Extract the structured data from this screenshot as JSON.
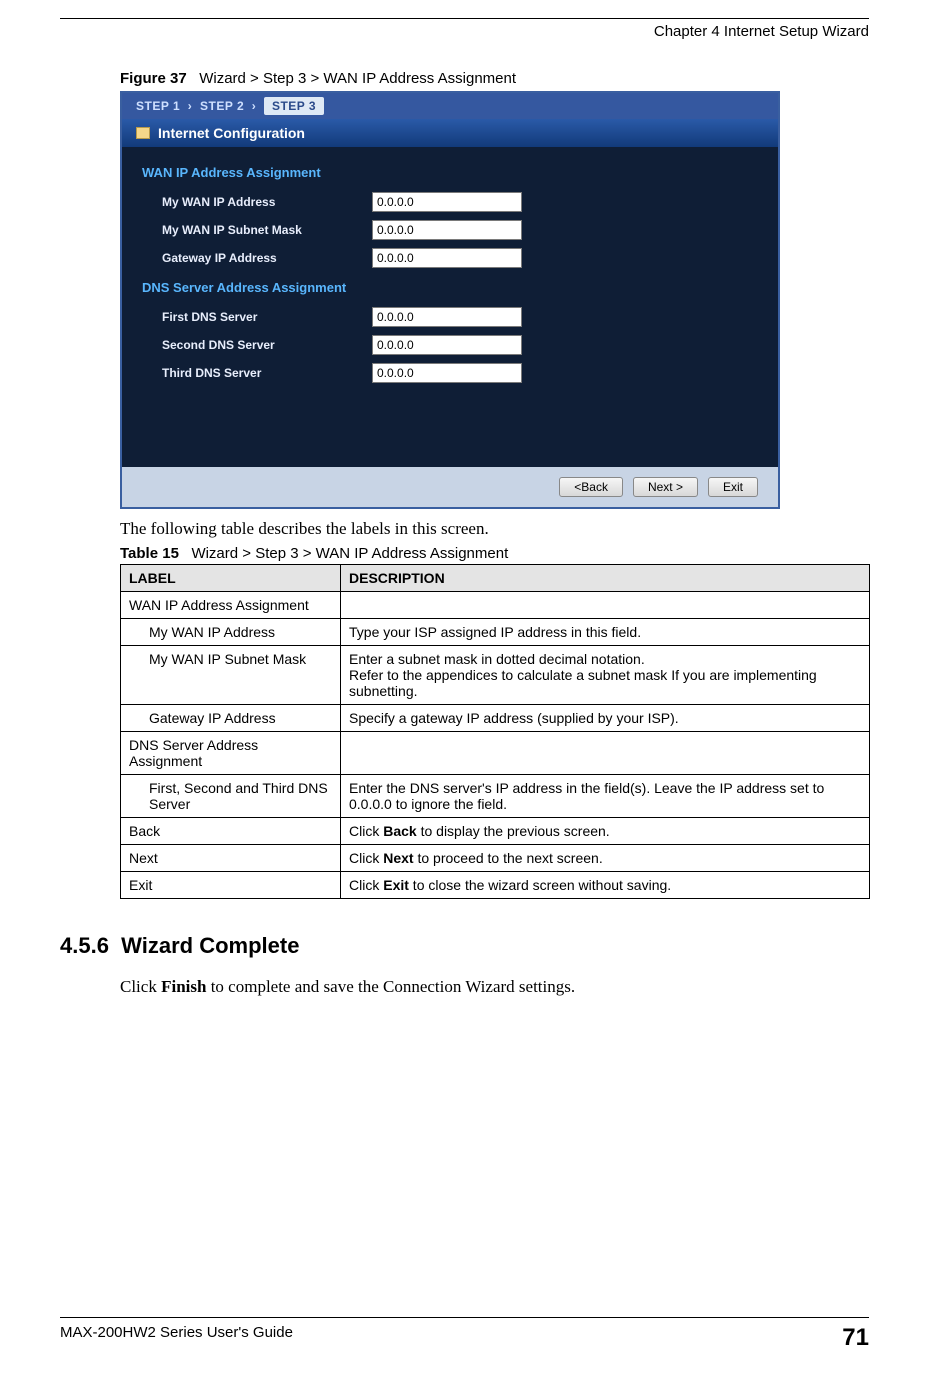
{
  "header": {
    "chapter": "Chapter 4 Internet Setup Wizard"
  },
  "figure": {
    "label": "Figure 37",
    "caption": "Wizard > Step 3 > WAN IP Address Assignment"
  },
  "screenshot": {
    "steps": {
      "s1": "STEP 1",
      "s2": "STEP 2",
      "s3": "STEP 3"
    },
    "panel_title": "Internet Configuration",
    "wan_section": "WAN IP Address Assignment",
    "wan_fields": {
      "ip_label": "My WAN IP Address",
      "ip_value": "0.0.0.0",
      "mask_label": "My WAN IP Subnet Mask",
      "mask_value": "0.0.0.0",
      "gw_label": "Gateway IP Address",
      "gw_value": "0.0.0.0"
    },
    "dns_section": "DNS Server Address Assignment",
    "dns_fields": {
      "d1_label": "First DNS Server",
      "d1_value": "0.0.0.0",
      "d2_label": "Second DNS Server",
      "d2_value": "0.0.0.0",
      "d3_label": "Third DNS Server",
      "d3_value": "0.0.0.0"
    },
    "buttons": {
      "back": "<Back",
      "next": "Next >",
      "exit": "Exit"
    }
  },
  "body": {
    "intro": "The following table describes the labels in this screen."
  },
  "table": {
    "label": "Table 15",
    "caption": "Wizard > Step 3 > WAN IP Address Assignment",
    "headers": {
      "c1": "LABEL",
      "c2": "DESCRIPTION"
    },
    "rows": [
      {
        "label": "WAN IP Address Assignment",
        "desc": "",
        "indent": false
      },
      {
        "label": "My WAN IP Address",
        "desc": "Type your ISP assigned IP address in this field.",
        "indent": true
      },
      {
        "label": "My WAN IP Subnet Mask",
        "desc": "Enter a subnet mask in dotted decimal notation.\nRefer to the appendices to calculate a subnet mask If you are implementing subnetting.",
        "indent": true
      },
      {
        "label": "Gateway IP Address",
        "desc": "Specify a gateway IP address (supplied by your ISP).",
        "indent": true
      },
      {
        "label": "DNS Server Address Assignment",
        "desc": "",
        "indent": false
      },
      {
        "label": "First, Second and Third DNS Server",
        "desc": "Enter the DNS server's IP address in the field(s). Leave the IP address set to 0.0.0.0 to ignore the field.",
        "indent": true
      },
      {
        "label": "Back",
        "desc_pre": "Click ",
        "desc_bold": "Back",
        "desc_post": " to display the previous screen.",
        "indent": false
      },
      {
        "label": "Next",
        "desc_pre": "Click ",
        "desc_bold": "Next",
        "desc_post": " to proceed to the next screen.",
        "indent": false
      },
      {
        "label": "Exit",
        "desc_pre": "Click ",
        "desc_bold": "Exit",
        "desc_post": " to close the wizard screen without saving.",
        "indent": false
      }
    ]
  },
  "section": {
    "num": "4.5.6",
    "title": "Wizard Complete",
    "para_pre": "Click ",
    "para_bold": "Finish",
    "para_post": " to complete and save the Connection Wizard settings."
  },
  "footer": {
    "guide": "MAX-200HW2 Series User's Guide",
    "page": "71"
  }
}
